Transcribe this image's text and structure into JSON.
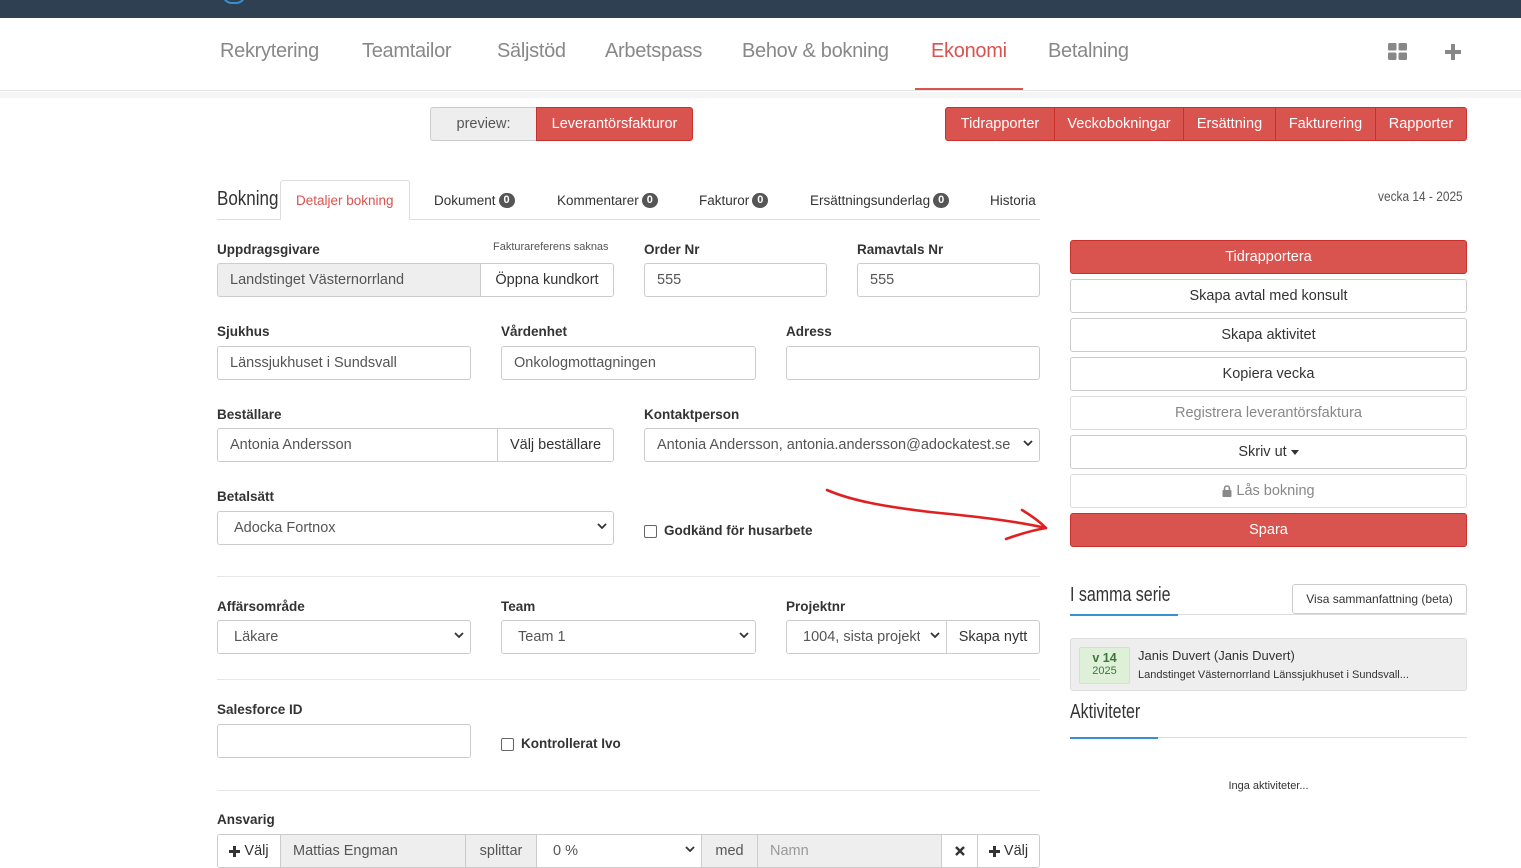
{
  "nav": {
    "items": [
      "Rekrytering",
      "Teamtailor",
      "Säljstöd",
      "Arbetspass",
      "Behov & bokning",
      "Ekonomi",
      "Betalning"
    ],
    "active": "Ekonomi"
  },
  "toolbar": {
    "preview_label": "preview:",
    "leverantorsfakturor": "Leverantörsfakturor",
    "right_buttons": [
      "Tidrapporter",
      "Veckobokningar",
      "Ersättning",
      "Fakturering",
      "Rapporter"
    ]
  },
  "booking": {
    "heading": "Bokning",
    "week": "vecka 14 - 2025",
    "tabs": [
      {
        "label": "Detaljer bokning"
      },
      {
        "label": "Dokument",
        "badge": "0"
      },
      {
        "label": "Kommentarer",
        "badge": "0"
      },
      {
        "label": "Fakturor",
        "badge": "0"
      },
      {
        "label": "Ersättningsunderlag",
        "badge": "0"
      },
      {
        "label": "Historia"
      }
    ]
  },
  "form": {
    "uppdragsgivare_label": "Uppdragsgivare",
    "fakturareferens_note": "Fakturareferens saknas",
    "uppdragsgivare_value": "Landstinget Västernorrland",
    "open_kundkort": "Öppna kundkort",
    "order_label": "Order Nr",
    "order_value": "555",
    "ramavtal_label": "Ramavtals Nr",
    "ramavtal_value": "555",
    "sjukhus_label": "Sjukhus",
    "sjukhus_value": "Länssjukhuset i Sundsvall",
    "vardenhet_label": "Vårdenhet",
    "vardenhet_value": "Onkologmottagningen",
    "adress_label": "Adress",
    "adress_value": "",
    "bestallare_label": "Beställare",
    "bestallare_value": "Antonia  Andersson",
    "valj_bestallare": "Välj beställare",
    "kontakt_label": "Kontaktperson",
    "kontakt_value": "Antonia Andersson, antonia.andersson@adockatest.se",
    "betalsatt_label": "Betalsätt",
    "betalsatt_value": "Adocka Fortnox",
    "husarbete_label": "Godkänd för husarbete",
    "affarsomrade_label": "Affärsområde",
    "affarsomrade_value": "Läkare",
    "team_label": "Team",
    "team_value": "Team 1",
    "projekt_label": "Projektnr",
    "projekt_value": "1004, sista projekt",
    "skapa_nytt": "Skapa nytt",
    "salesforce_label": "Salesforce ID",
    "salesforce_value": "",
    "ivo_label": "Kontrollerat Ivo",
    "ansvarig_label": "Ansvarig",
    "valj": "Välj",
    "ansvarig_value": "Mattias Engman",
    "splittar": "splittar",
    "percent_value": "0 %",
    "med": "med",
    "namn_placeholder": "Namn",
    "valj2": "Välj"
  },
  "actions": {
    "tidrapportera": "Tidrapportera",
    "skapa_avtal": "Skapa avtal med konsult",
    "skapa_aktivitet": "Skapa aktivitet",
    "kopiera_vecka": "Kopiera vecka",
    "registrera": "Registrera leverantörsfaktura",
    "skriv_ut": "Skriv ut",
    "las_bokning": "Lås bokning",
    "spara": "Spara"
  },
  "serie": {
    "heading": "I samma serie",
    "summary_button": "Visa sammanfattning (beta)",
    "week": "v 14",
    "year": "2025",
    "name": "Janis Duvert (Janis Duvert)",
    "place": "Landstinget Västernorrland Länssjukhuset i Sundsvall..."
  },
  "aktiviteter": {
    "heading": "Aktiviteter",
    "empty": "Inga aktiviteter..."
  },
  "colors": {
    "accent": "#d9534f",
    "topbar": "#2f4052",
    "annotation": "#e02020"
  }
}
